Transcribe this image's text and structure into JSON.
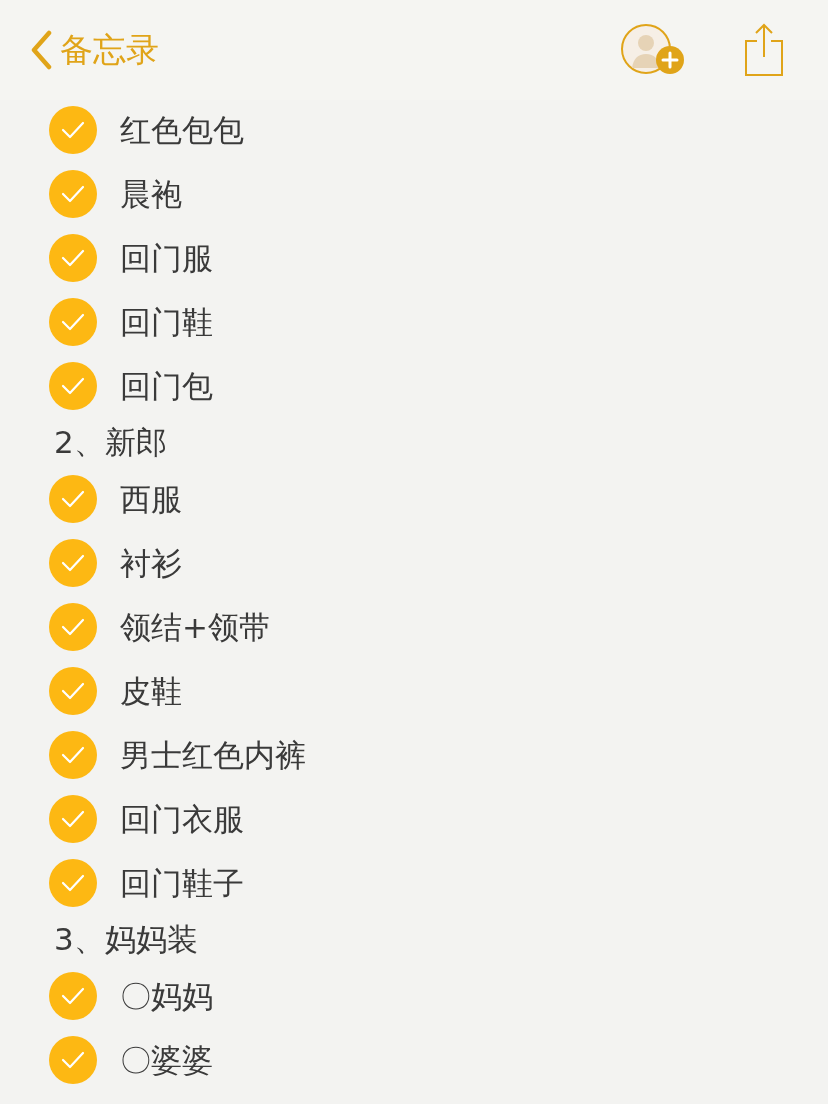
{
  "nav": {
    "back_label": "备忘录"
  },
  "items": [
    {
      "kind": "check",
      "text": "红色包包",
      "checked": true
    },
    {
      "kind": "check",
      "text": "晨袍",
      "checked": true
    },
    {
      "kind": "check",
      "text": "回门服",
      "checked": true
    },
    {
      "kind": "check",
      "text": "回门鞋",
      "checked": true
    },
    {
      "kind": "check",
      "text": "回门包",
      "checked": true
    },
    {
      "kind": "heading",
      "text": "2、新郎"
    },
    {
      "kind": "check",
      "text": "西服",
      "checked": true
    },
    {
      "kind": "check",
      "text": "衬衫",
      "checked": true
    },
    {
      "kind": "check",
      "text": "领结+领带",
      "checked": true
    },
    {
      "kind": "check",
      "text": "皮鞋",
      "checked": true
    },
    {
      "kind": "check",
      "text": "男士红色内裤",
      "checked": true
    },
    {
      "kind": "check",
      "text": "回门衣服",
      "checked": true
    },
    {
      "kind": "check",
      "text": "回门鞋子",
      "checked": true
    },
    {
      "kind": "heading",
      "text": "3、妈妈装"
    },
    {
      "kind": "check",
      "text": "〇妈妈",
      "checked": true
    },
    {
      "kind": "check",
      "text": "〇婆婆",
      "checked": true
    }
  ]
}
